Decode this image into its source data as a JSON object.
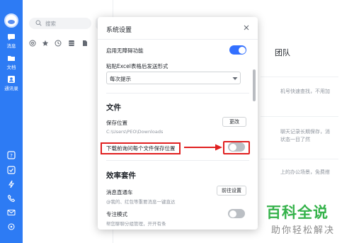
{
  "rail": {
    "items": [
      {
        "icon": "chat-icon",
        "label": "消息"
      },
      {
        "icon": "document-icon",
        "label": "文档"
      },
      {
        "icon": "contacts-icon",
        "label": "通讯录"
      }
    ],
    "bottom_icons": [
      "help-icon",
      "todo-icon",
      "bolt-icon",
      "phone-icon",
      "mail-icon",
      "more-icon"
    ]
  },
  "list": {
    "search_placeholder": "搜索",
    "tools": [
      "at-icon",
      "star-icon",
      "clock-icon",
      "table-icon",
      "file-icon"
    ]
  },
  "background": {
    "title": "团队",
    "lines": [
      "机号快速查找，不用加",
      "聊天记录长期保存，消",
      "状态一目了然",
      "上的办公场景，免费搭"
    ]
  },
  "modal": {
    "title": "系统设置",
    "accessibility_label": "启用无障碍功能",
    "accessibility_on": true,
    "paste_label": "粘贴Excel表格后发送形式",
    "paste_value": "每次提示",
    "file_section": "文件",
    "save_location_label": "保存位置",
    "save_location_path": "C:\\Users\\PEO\\Downloads",
    "change_button": "更改",
    "ask_location_label": "下载前询问每个文件保存位置",
    "ask_location_on": false,
    "efficiency_section": "效率套件",
    "msg_train_label": "消息直通车",
    "msg_train_sub": "@我的、红包等重要消息一键直达",
    "go_settings_button": "前往设置",
    "focus_label": "专注模式",
    "focus_sub": "帮您聊聊分组管理，开开有条",
    "focus_on": false
  },
  "watermark": {
    "big": "百科全说",
    "small": "助你轻松解决"
  },
  "colors": {
    "rail": "#2d7bf4",
    "toggle_on": "#3370ff",
    "annotation": "#e02020",
    "watermark": "#34b24a"
  }
}
